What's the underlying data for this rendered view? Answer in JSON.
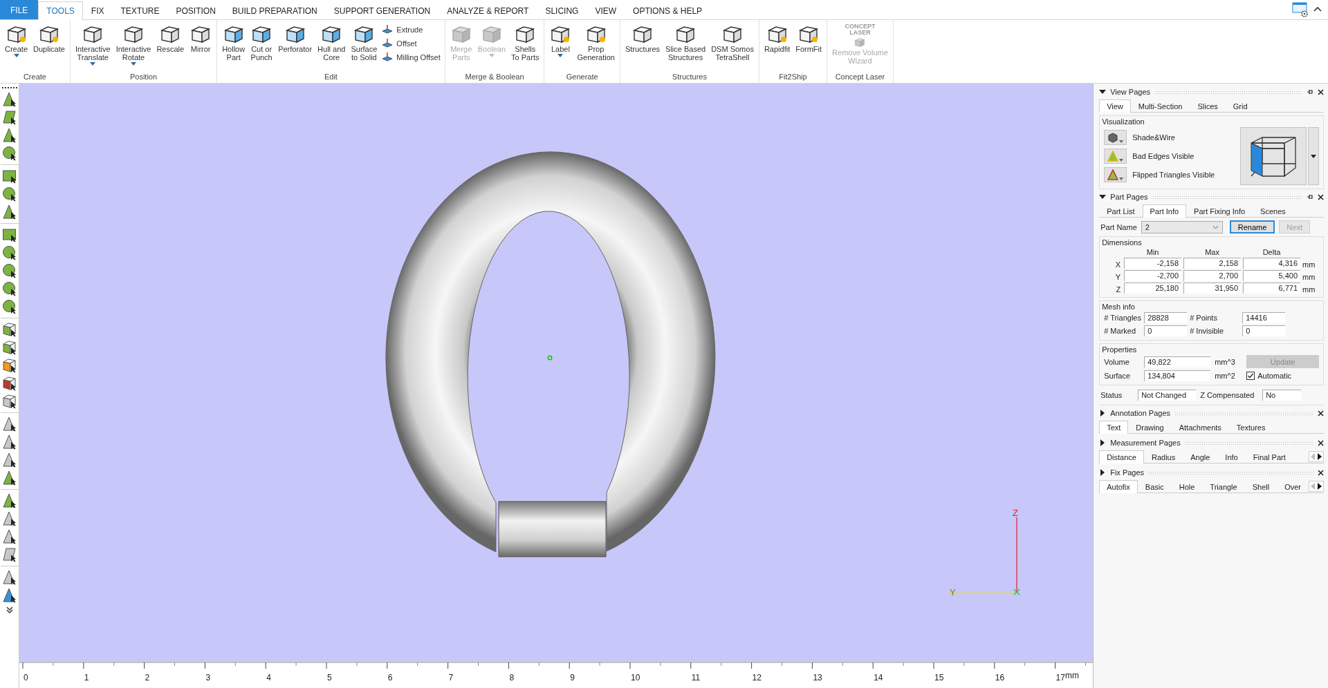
{
  "menu_tabs": [
    {
      "label": "FILE",
      "kind": "file",
      "selected": false
    },
    {
      "label": "TOOLS",
      "kind": "tab",
      "selected": true
    },
    {
      "label": "FIX",
      "kind": "tab",
      "selected": false
    },
    {
      "label": "TEXTURE",
      "kind": "tab",
      "selected": false
    },
    {
      "label": "POSITION",
      "kind": "tab",
      "selected": false
    },
    {
      "label": "BUILD PREPARATION",
      "kind": "tab",
      "selected": false
    },
    {
      "label": "SUPPORT GENERATION",
      "kind": "tab",
      "selected": false
    },
    {
      "label": "ANALYZE & REPORT",
      "kind": "tab",
      "selected": false
    },
    {
      "label": "SLICING",
      "kind": "tab",
      "selected": false
    },
    {
      "label": "VIEW",
      "kind": "tab",
      "selected": false
    },
    {
      "label": "OPTIONS & HELP",
      "kind": "tab",
      "selected": false
    }
  ],
  "ribbon_groups": [
    {
      "label": "Create",
      "tools": [
        {
          "label": "Create",
          "dropdown": true,
          "disabled": false
        },
        {
          "label": "Duplicate",
          "dropdown": false,
          "disabled": false
        }
      ]
    },
    {
      "label": "Position",
      "tools": [
        {
          "label": "Interactive\nTranslate",
          "dropdown": true,
          "disabled": false
        },
        {
          "label": "Interactive\nRotate",
          "dropdown": true,
          "disabled": false
        },
        {
          "label": "Rescale",
          "dropdown": false,
          "disabled": false
        },
        {
          "label": "Mirror",
          "dropdown": false,
          "disabled": false
        }
      ]
    },
    {
      "label": "Edit",
      "tools": [
        {
          "label": "Hollow\nPart",
          "dropdown": false,
          "disabled": false
        },
        {
          "label": "Cut or\nPunch",
          "dropdown": false,
          "disabled": false
        },
        {
          "label": "Perforator",
          "dropdown": false,
          "disabled": false
        },
        {
          "label": "Hull and\nCore",
          "dropdown": false,
          "disabled": false
        },
        {
          "label": "Surface\nto Solid",
          "dropdown": false,
          "disabled": false
        }
      ],
      "small_tools": [
        {
          "label": "Extrude"
        },
        {
          "label": "Offset"
        },
        {
          "label": "Milling Offset"
        }
      ]
    },
    {
      "label": "Merge & Boolean",
      "tools": [
        {
          "label": "Merge\nParts",
          "dropdown": false,
          "disabled": true
        },
        {
          "label": "Boolean",
          "dropdown": true,
          "disabled": true
        },
        {
          "label": "Shells\nTo Parts",
          "dropdown": false,
          "disabled": false
        }
      ]
    },
    {
      "label": "Generate",
      "tools": [
        {
          "label": "Label",
          "dropdown": true,
          "disabled": false
        },
        {
          "label": "Prop\nGeneration",
          "dropdown": false,
          "disabled": false
        }
      ]
    },
    {
      "label": "Structures",
      "tools": [
        {
          "label": "Structures",
          "dropdown": false,
          "disabled": false
        },
        {
          "label": "Slice Based\nStructures",
          "dropdown": false,
          "disabled": false
        },
        {
          "label": "DSM Somos\nTetraShell",
          "dropdown": false,
          "disabled": false
        }
      ]
    },
    {
      "label": "Fit2Ship",
      "tools": [
        {
          "label": "Rapidfit",
          "dropdown": false,
          "disabled": false
        },
        {
          "label": "FormFit",
          "dropdown": false,
          "disabled": false
        }
      ]
    },
    {
      "label": "Concept Laser",
      "tools": [
        {
          "label": "Remove Volume\nWizard",
          "dropdown": false,
          "disabled": true,
          "logo_text": "CONCEPT\nLASER"
        }
      ]
    }
  ],
  "viewport": {
    "axis_labels": [
      "Z",
      "Y"
    ]
  },
  "ruler": {
    "labels": [
      "0",
      "1",
      "2",
      "3",
      "4",
      "5",
      "6",
      "7",
      "8",
      "9",
      "10",
      "11",
      "12",
      "13",
      "14",
      "15",
      "16",
      "17"
    ],
    "unit": "mm"
  },
  "view_pages": {
    "title": "View Pages",
    "expanded": true,
    "tabs": [
      {
        "label": "View",
        "selected": true
      },
      {
        "label": "Multi-Section",
        "selected": false
      },
      {
        "label": "Slices",
        "selected": false
      },
      {
        "label": "Grid",
        "selected": false
      }
    ],
    "visualization": {
      "title": "Visualization",
      "options": [
        {
          "label": "Shade&Wire",
          "kind": "shade"
        },
        {
          "label": "Bad Edges Visible",
          "kind": "edges"
        },
        {
          "label": "Flipped Triangles Visible",
          "kind": "flipped"
        }
      ]
    }
  },
  "part_pages": {
    "title": "Part Pages",
    "expanded": true,
    "tabs": [
      {
        "label": "Part List",
        "selected": false
      },
      {
        "label": "Part Info",
        "selected": true
      },
      {
        "label": "Part Fixing Info",
        "selected": false
      },
      {
        "label": "Scenes",
        "selected": false
      }
    ],
    "part_name": {
      "label": "Part Name",
      "value": "2"
    },
    "buttons": [
      {
        "label": "Rename",
        "disabled": false,
        "focused": true
      },
      {
        "label": "Next",
        "disabled": true,
        "focused": false
      }
    ],
    "dimensions": {
      "title": "Dimensions",
      "columns": [
        "Min",
        "Max",
        "Delta"
      ],
      "rows": [
        {
          "axis": "X",
          "min": "-2,158",
          "max": "2,158",
          "delta": "4,316",
          "unit": "mm"
        },
        {
          "axis": "Y",
          "min": "-2,700",
          "max": "2,700",
          "delta": "5,400",
          "unit": "mm"
        },
        {
          "axis": "Z",
          "min": "25,180",
          "max": "31,950",
          "delta": "6,771",
          "unit": "mm"
        }
      ]
    },
    "mesh_info": {
      "title": "Mesh info",
      "fields": [
        {
          "label": "# Triangles",
          "value": "28828"
        },
        {
          "label": "# Points",
          "value": "14416"
        },
        {
          "label": "# Marked",
          "value": "0"
        },
        {
          "label": "# Invisible",
          "value": "0"
        }
      ]
    },
    "properties": {
      "title": "Properties",
      "fields": [
        {
          "label": "Volume",
          "value": "49,822",
          "unit": "mm^3"
        },
        {
          "label": "Surface",
          "value": "134,804",
          "unit": "mm^2"
        }
      ],
      "update_button": {
        "label": "Update",
        "disabled": true
      },
      "automatic": {
        "label": "Automatic",
        "checked": true
      }
    },
    "status": {
      "label": "Status",
      "value": "Not Changed"
    },
    "z_compensated": {
      "label": "Z Compensated",
      "value": "No"
    }
  },
  "collapsed_pages": [
    {
      "title": "Annotation Pages",
      "expanded": false,
      "scroll_arrows": false,
      "tabs": [
        {
          "label": "Text",
          "selected": true
        },
        {
          "label": "Drawing",
          "selected": false
        },
        {
          "label": "Attachments",
          "selected": false
        },
        {
          "label": "Textures",
          "selected": false
        }
      ]
    },
    {
      "title": "Measurement Pages",
      "expanded": false,
      "scroll_arrows": true,
      "tabs": [
        {
          "label": "Distance",
          "selected": true
        },
        {
          "label": "Radius",
          "selected": false
        },
        {
          "label": "Angle",
          "selected": false
        },
        {
          "label": "Info",
          "selected": false
        },
        {
          "label": "Final Part",
          "selected": false
        }
      ]
    },
    {
      "title": "Fix Pages",
      "expanded": false,
      "scroll_arrows": true,
      "tabs": [
        {
          "label": "Autofix",
          "selected": true
        },
        {
          "label": "Basic",
          "selected": false
        },
        {
          "label": "Hole",
          "selected": false
        },
        {
          "label": "Triangle",
          "selected": false
        },
        {
          "label": "Shell",
          "selected": false
        },
        {
          "label": "Over",
          "selected": false
        }
      ]
    }
  ]
}
